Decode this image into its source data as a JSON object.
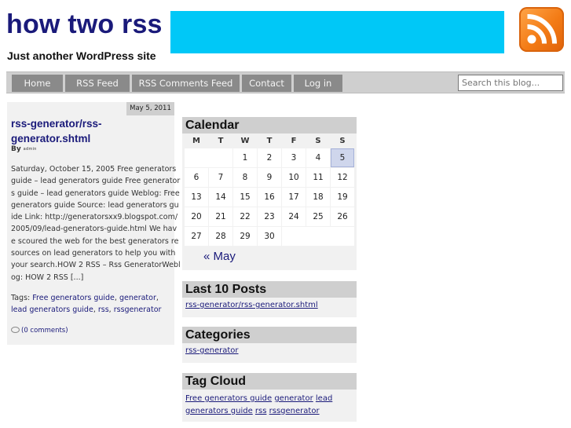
{
  "site": {
    "title": "how two rss",
    "tagline": "Just another WordPress site"
  },
  "header": {
    "rss_logo_icon": "rss-feed-icon"
  },
  "nav": {
    "items": [
      {
        "label": "Home"
      },
      {
        "label": "RSS Feed"
      },
      {
        "label": "RSS Comments Feed"
      },
      {
        "label": "Contact"
      },
      {
        "label": "Log in"
      }
    ],
    "search_placeholder": "Search this blog..."
  },
  "post": {
    "date": "May 5, 2011",
    "title": "rss-generator/rss-generator.shtml",
    "by_label": "By",
    "author": "admin",
    "excerpt": "Saturday, October 15, 2005 Free generators guide – lead generators guide Free generators guide – lead generators guide Weblog: Free generators guide Source: lead generators guide Link: http://generatorsxx9.blogspot.com/2005/09/lead-generators-guide.html We have scoured the web for the best generators resources on lead generators to help you with your search.HOW 2 RSS – Rss GeneratorWeblog: HOW 2 RSS [...]",
    "tags_label": "Tags:",
    "tags": [
      "Free generators guide",
      "generator",
      "lead generators guide",
      "rss",
      "rssgenerator"
    ],
    "comments": "(0 comments)"
  },
  "calendar": {
    "title": "Calendar",
    "weekdays": [
      "M",
      "T",
      "W",
      "T",
      "F",
      "S",
      "S"
    ],
    "weeks": [
      [
        "",
        "",
        "1",
        "2",
        "3",
        "4",
        "5"
      ],
      [
        "6",
        "7",
        "8",
        "9",
        "10",
        "11",
        "12"
      ],
      [
        "13",
        "14",
        "15",
        "16",
        "17",
        "18",
        "19"
      ],
      [
        "20",
        "21",
        "22",
        "23",
        "24",
        "25",
        "26"
      ],
      [
        "27",
        "28",
        "29",
        "30",
        "",
        "",
        ""
      ]
    ],
    "highlighted_day": "5",
    "prev_link": "« May"
  },
  "last_posts": {
    "title": "Last 10 Posts",
    "items": [
      "rss-generator/rss-generator.shtml"
    ]
  },
  "categories": {
    "title": "Categories",
    "items": [
      "rss-generator"
    ]
  },
  "tag_cloud": {
    "title": "Tag Cloud",
    "tags": [
      "Free generators guide",
      "generator",
      "lead generators guide",
      "rss",
      "rssgenerator"
    ]
  },
  "colors": {
    "title": "#1a1a7a",
    "banner": "#00c8f7",
    "nav_item": "#8a8a8a",
    "nav_bar": "#cfcfcf",
    "rss_orange": "#f37b15"
  }
}
